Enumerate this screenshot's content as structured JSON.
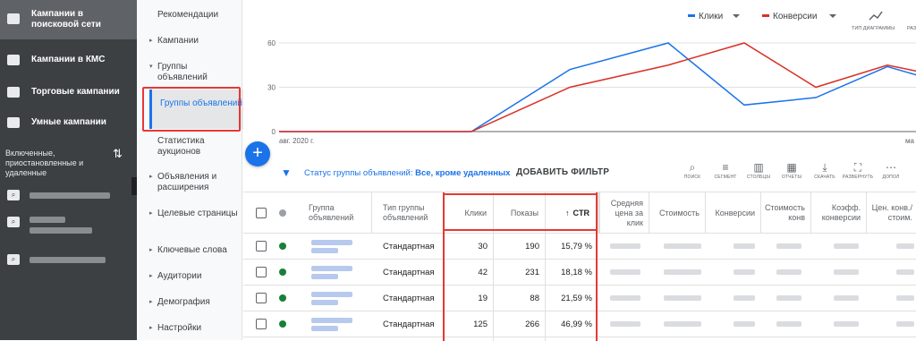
{
  "left_nav": {
    "items": [
      {
        "label": "Кампании в поисковой сети",
        "icon": "search-campaign-icon",
        "active": true
      },
      {
        "label": "Кампании в КМС",
        "icon": "display-campaign-icon"
      },
      {
        "label": "Торговые кампании",
        "icon": "shopping-campaign-icon"
      },
      {
        "label": "Умные кампании",
        "icon": "smart-campaign-icon"
      }
    ],
    "filter_label": "Включенные, приостановленные и удаленные"
  },
  "sub_nav": {
    "items": [
      "Рекомендации",
      "Кампании",
      "Группы объявлений",
      "Группы объявлений",
      "Статистика аукционов",
      "Объявления и расширения",
      "Целевые страницы",
      "Ключевые слова",
      "Аудитории",
      "Демография",
      "Настройки"
    ]
  },
  "chart_data": {
    "type": "line",
    "x": [
      "авг. 2020 г.",
      "",
      "",
      "",
      "",
      "",
      "",
      "",
      "",
      "",
      "",
      "ма"
    ],
    "ylim": [
      0,
      60
    ],
    "yticks": [
      0,
      30,
      60
    ],
    "series": [
      {
        "name": "Клики",
        "color": "#1a73e8",
        "values": [
          0,
          0,
          0,
          42,
          60,
          18,
          23,
          44,
          30
        ]
      },
      {
        "name": "Конверсии",
        "color": "#d93025",
        "values": [
          0,
          0,
          0,
          30,
          45,
          60,
          30,
          45,
          35
        ]
      }
    ],
    "chart_type_label": "ТИП ДИАГРАММЫ",
    "extra_label": "РАЗ",
    "end_label": "ма"
  },
  "filter": {
    "status_prefix": "Статус группы объявлений:",
    "status_value": "Все, кроме удаленных",
    "add_filter": "ДОБАВИТЬ ФИЛЬТР"
  },
  "toolbar": [
    {
      "label": "ПОИСК",
      "icon": "search-icon"
    },
    {
      "label": "СЕГМЕНТ",
      "icon": "segment-icon"
    },
    {
      "label": "СТОЛБЦЫ",
      "icon": "columns-icon"
    },
    {
      "label": "ОТЧЕТЫ",
      "icon": "reports-icon"
    },
    {
      "label": "СКАЧАТЬ",
      "icon": "download-icon"
    },
    {
      "label": "РАЗВЕРНУТЬ",
      "icon": "expand-icon"
    },
    {
      "label": "ДОПОЛ",
      "icon": "more-icon"
    }
  ],
  "table": {
    "headers": [
      "Группа объявлений",
      "Тип группы объявлений",
      "Клики",
      "Показы",
      "CTR",
      "Средняя цена за клик",
      "Стоимость",
      "Конверсии",
      "Стоимость конв",
      "Коэфф. конверсии",
      "Цен. конв./ стоим."
    ],
    "rows": [
      {
        "type": "Стандартная",
        "clicks": "30",
        "impr": "190",
        "ctr": "15,79 %"
      },
      {
        "type": "Стандартная",
        "clicks": "42",
        "impr": "231",
        "ctr": "18,18 %"
      },
      {
        "type": "Стандартная",
        "clicks": "19",
        "impr": "88",
        "ctr": "21,59 %"
      },
      {
        "type": "Стандартная",
        "clicks": "125",
        "impr": "266",
        "ctr": "46,99 %"
      }
    ]
  }
}
